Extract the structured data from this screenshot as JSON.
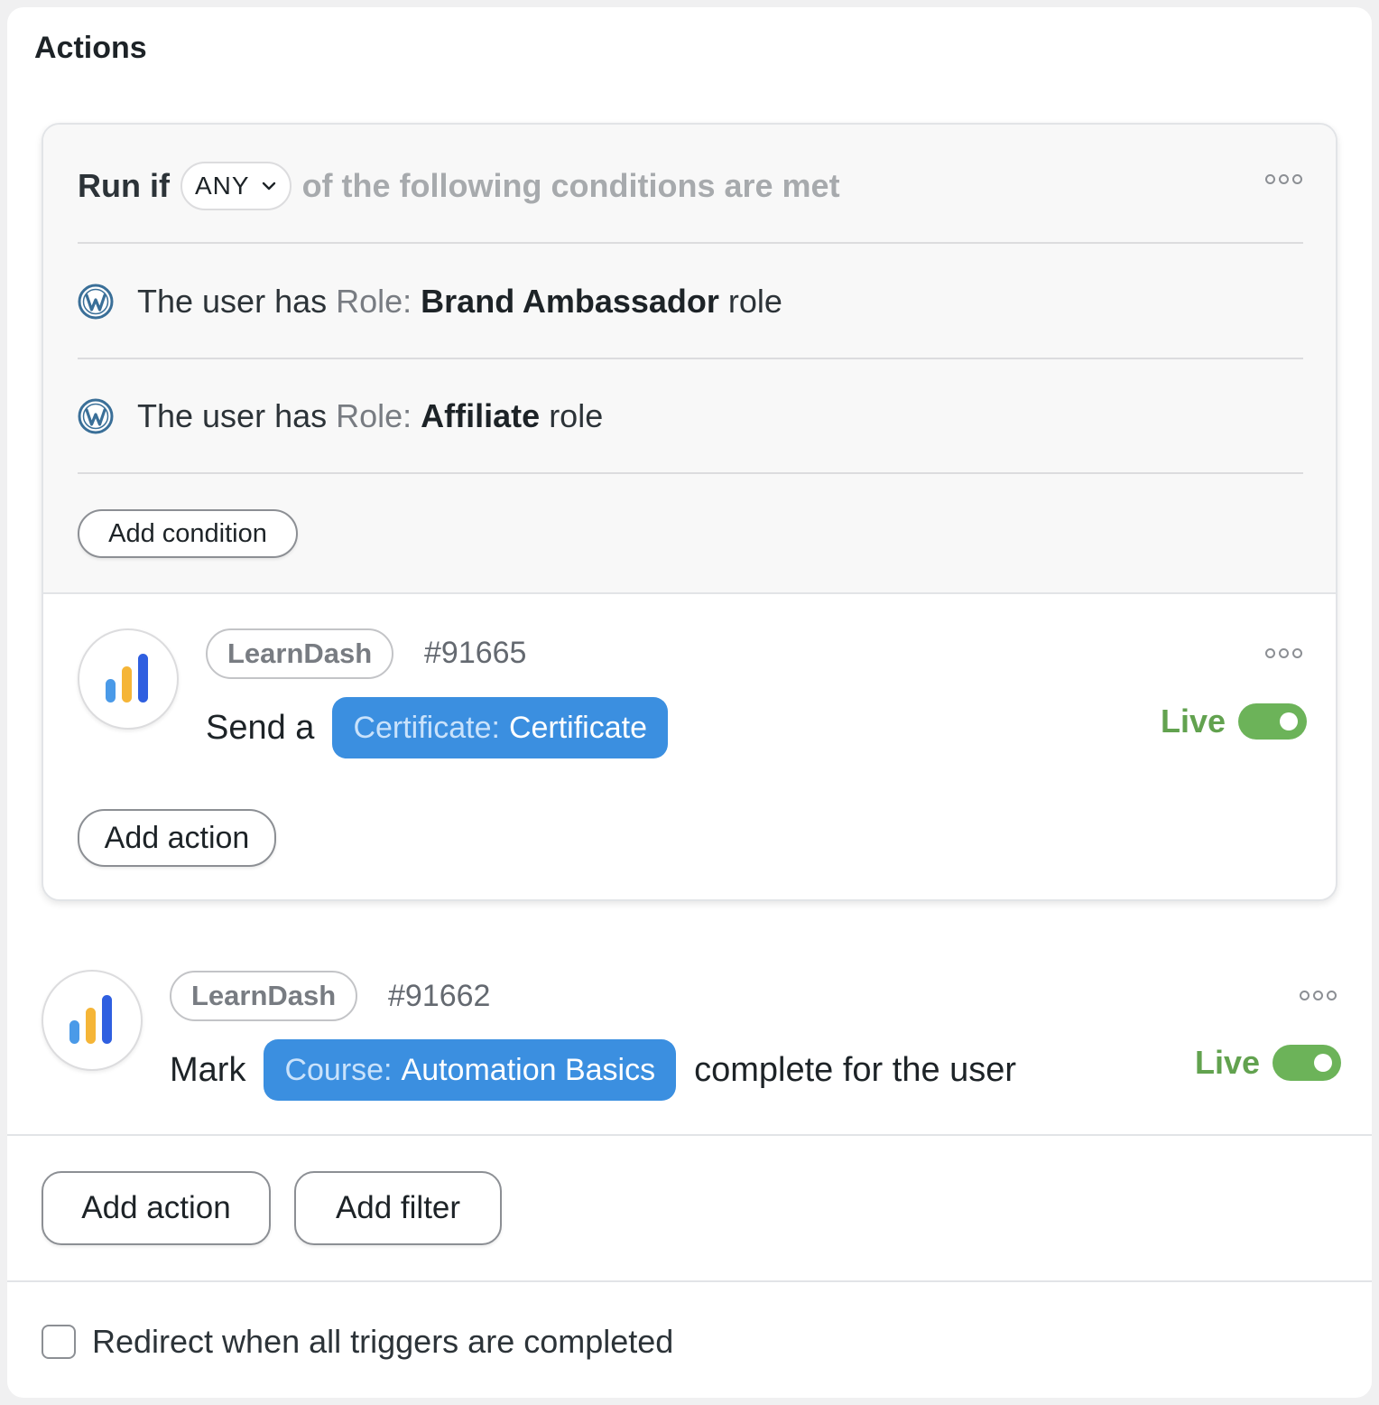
{
  "panel": {
    "title": "Actions"
  },
  "filter": {
    "run_if": "Run if",
    "match_mode": "ANY",
    "run_if_rest": "of the following conditions are met",
    "conditions": [
      {
        "prefix": "The user has",
        "field": "Role:",
        "value": "Brand Ambassador",
        "suffix": "role",
        "icon": "wordpress-icon"
      },
      {
        "prefix": "The user has",
        "field": "Role:",
        "value": "Affiliate",
        "suffix": "role",
        "icon": "wordpress-icon"
      }
    ],
    "add_condition_label": "Add condition",
    "add_action_label": "Add action"
  },
  "actions": [
    {
      "integration": "LearnDash",
      "id": "#91665",
      "verb": "Send a",
      "token_key": "Certificate:",
      "token_value": "Certificate",
      "tail": "",
      "status": "Live",
      "live": true
    },
    {
      "integration": "LearnDash",
      "id": "#91662",
      "verb": "Mark",
      "token_key": "Course:",
      "token_value": "Automation Basics",
      "tail": "complete for the user",
      "status": "Live",
      "live": true
    }
  ],
  "footer": {
    "add_action_label": "Add action",
    "add_filter_label": "Add filter",
    "redirect_label": "Redirect when all triggers are completed",
    "redirect_checked": false
  },
  "colors": {
    "token": "#3b8fe0",
    "live": "#62a24f",
    "toggle": "#6cb359"
  }
}
